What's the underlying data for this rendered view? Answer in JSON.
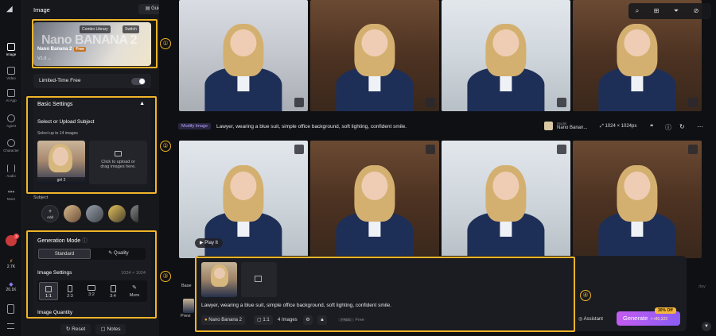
{
  "rail": {
    "items": [
      {
        "label": "Image",
        "icon": "image-icon"
      },
      {
        "label": "Video",
        "icon": "video-icon"
      },
      {
        "label": "AI App",
        "icon": "ai-app-icon"
      },
      {
        "label": "Agent",
        "icon": "agent-icon"
      },
      {
        "label": "Character",
        "icon": "character-icon"
      },
      {
        "label": "Audio",
        "icon": "audio-icon"
      },
      {
        "label": "More",
        "icon": "more-icon"
      }
    ],
    "notif_count": "3",
    "credits": [
      "2.7K",
      "20.1K"
    ]
  },
  "panel": {
    "title": "Image",
    "guides_label": "Guides",
    "model": {
      "big_name": "Nano BANANA 2",
      "name": "Nano Banana 2",
      "badge": "Free",
      "version": "V1.0",
      "combo_label": "Combo Library",
      "switch_label": "Switch"
    },
    "limited_free_label": "Limited-Time Free",
    "basic_settings": {
      "header": "Basic Settings",
      "select_label": "Select or Upload Subject",
      "select_sub": "Select up to 14 images",
      "thumb_label": "girl 2",
      "upload_text_1": "Click to upload or",
      "upload_text_2": "drag images here."
    },
    "subject_label": "Subject",
    "add_label": "Add",
    "generation": {
      "mode_label": "Generation Mode",
      "standard_label": "Standard",
      "quality_label": "Quality",
      "image_settings_label": "Image Settings",
      "resolution": "1024 × 1024",
      "ratios": [
        "1:1",
        "2:3",
        "3:2",
        "3:4",
        "More"
      ],
      "quantity_label": "Image Quantity"
    },
    "reset_label": "Reset",
    "notes_label": "Notes"
  },
  "annotations": [
    "①",
    "②",
    "③",
    "④"
  ],
  "main": {
    "modify_label": "Modify Image",
    "prompt": "Lawyer, wearing a blue suit, simple office background, soft lighting, confident smile.",
    "model_caption": "Model",
    "model_name": "Nano Banan...",
    "size": "1024 × 1024px",
    "play_label": "Play It",
    "side_labels": [
      "Base",
      "Previ",
      "day"
    ]
  },
  "composer": {
    "prompt": "Lawyer, wearing a blue suit, simple office background, soft lighting, confident smile.",
    "model_pill": "Nano Banana 2",
    "ratio_pill": "1:1",
    "count_pill": "4 Images",
    "free_badge": "FREE",
    "free_label": "Free",
    "assistant_label": "Assistant",
    "generate_label": "Generate",
    "generate_cost": "+80,322",
    "off_badge": "30% Off"
  },
  "colors": {
    "accent_highlight": "#f0b429",
    "generate_gradient_start": "#c45cf0",
    "generate_gradient_end": "#8a5cf6",
    "panel_bg": "#17181c",
    "page_bg": "#0f1013"
  }
}
